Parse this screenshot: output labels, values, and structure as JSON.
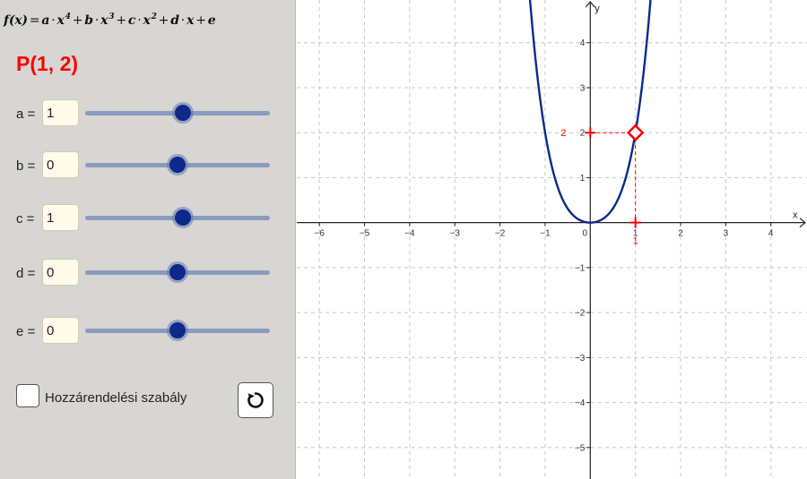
{
  "formula": {
    "f": "f(x)",
    "a": "a",
    "b": "b",
    "c": "c",
    "d": "d",
    "x": "x",
    "e": "e",
    "exp4": "4",
    "exp3": "3",
    "exp2": "2"
  },
  "point": {
    "label": "P(1, 2)",
    "x": 1,
    "y": 2
  },
  "sliders": [
    {
      "name": "a",
      "label": "a =",
      "value": "1",
      "fraction": 0.53
    },
    {
      "name": "b",
      "label": "b =",
      "value": "0",
      "fraction": 0.5
    },
    {
      "name": "c",
      "label": "c =",
      "value": "1",
      "fraction": 0.53
    },
    {
      "name": "d",
      "label": "d =",
      "value": "0",
      "fraction": 0.5
    },
    {
      "name": "e",
      "label": "e =",
      "value": "0",
      "fraction": 0.5
    }
  ],
  "checkbox": {
    "label": "Hozzárendelési szabály",
    "checked": false
  },
  "graph": {
    "x_axis_label": "x",
    "y_axis_label": "y",
    "x_range": [
      -6.5,
      4.8
    ],
    "y_range": [
      -5.7,
      4.95
    ],
    "x_ticks": [
      -6,
      -5,
      -4,
      -3,
      -2,
      -1,
      0,
      1,
      2,
      3,
      4
    ],
    "y_ticks": [
      -5,
      -4,
      -3,
      -2,
      -1,
      1,
      2,
      3,
      4
    ],
    "x_tick_labels": [
      "−6",
      "−5",
      "−4",
      "−3",
      "−2",
      "−1",
      "0",
      "1",
      "2",
      "3",
      "4"
    ],
    "y_tick_labels": [
      "−5",
      "−4",
      "−3",
      "−2",
      "−1",
      "1",
      "2",
      "3",
      "4"
    ],
    "coefficients": {
      "a": 1,
      "b": 0,
      "c": 1,
      "d": 0,
      "e": 0
    },
    "point_x_label": "1",
    "point_y_label": "2",
    "curve_color": "#0b2a8a",
    "point_color": "#ff0000",
    "grid": true
  }
}
